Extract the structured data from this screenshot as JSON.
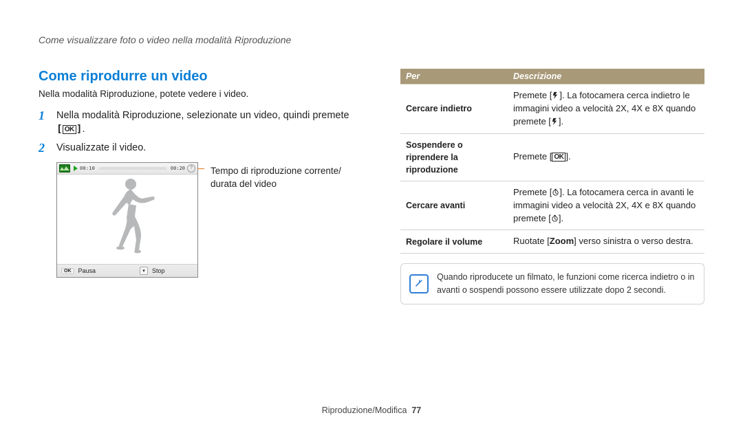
{
  "header": "Come visualizzare foto o video nella modalità Riproduzione",
  "left": {
    "heading": "Come riprodurre un video",
    "sub": "Nella modalità Riproduzione, potete vedere i video.",
    "steps": [
      "Nella modalità Riproduzione, selezionate un video, quindi premete",
      "Visualizzate il video."
    ],
    "ok_label": "OK",
    "shot": {
      "time_left": "00:10",
      "time_right": "00:20",
      "btn_pause_key": "OK",
      "btn_pause": "Pausa",
      "btn_stop": "Stop"
    },
    "caption_l1": "Tempo di riproduzione corrente/",
    "caption_l2": "durata del video"
  },
  "table": {
    "th1": "Per",
    "th2": "Descrizione",
    "rows": [
      {
        "label": "Cercare indietro",
        "desc_a": "Premete [",
        "desc_b": "]. La fotocamera cerca indietro le immagini video a velocità 2X, 4X e 8X quando premete [",
        "desc_c": "].",
        "icon": "flash"
      },
      {
        "label_l1": "Sospendere o",
        "label_l2": "riprendere la",
        "label_l3": "riproduzione",
        "desc_a": "Premete [",
        "ok": "OK",
        "desc_c": "]."
      },
      {
        "label": "Cercare avanti",
        "desc_a": "Premete [",
        "desc_b": "]. La fotocamera cerca in avanti le immagini video a velocità 2X, 4X e 8X quando premete [",
        "desc_c": "].",
        "icon": "timer"
      },
      {
        "label": "Regolare il volume",
        "desc_a": "Ruotate [",
        "zoom": "Zoom",
        "desc_b": "] verso sinistra o verso destra."
      }
    ]
  },
  "note": "Quando riproducete un filmato, le funzioni come ricerca indietro o in avanti o sospendi possono essere utilizzate dopo 2 secondi.",
  "footer_label": "Riproduzione/Modifica",
  "footer_page": "77"
}
